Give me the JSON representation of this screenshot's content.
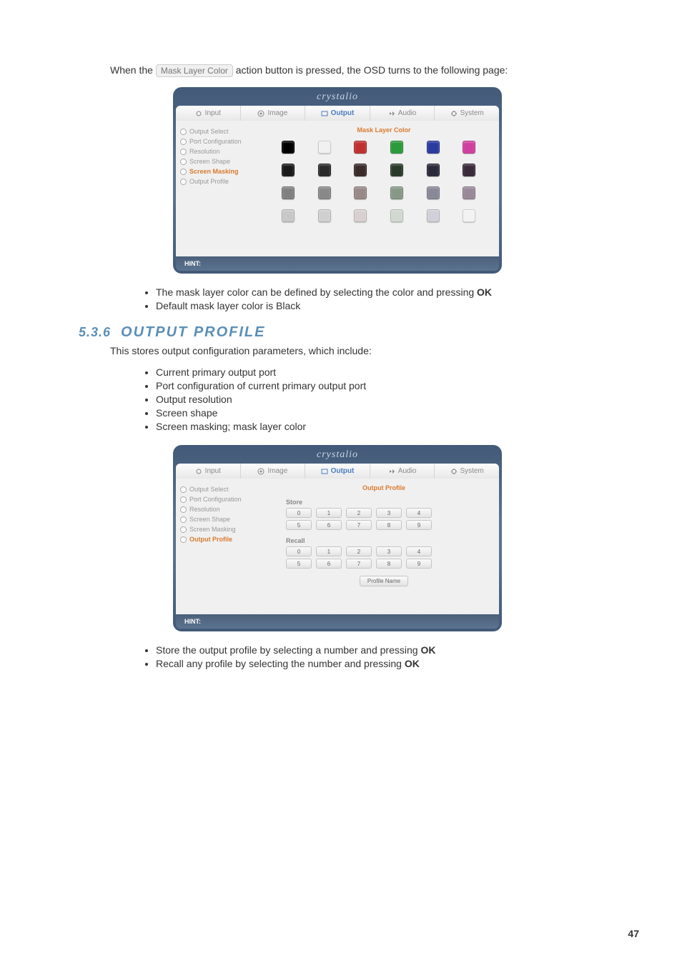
{
  "intro": {
    "prefix": "When the ",
    "pill": "Mask Layer Color",
    "suffix": " action button is pressed, the OSD turns to the following page:"
  },
  "osd1": {
    "logo": "crystalio",
    "tabs": [
      "Input",
      "Image",
      "Output",
      "Audio",
      "System"
    ],
    "active_tab": 2,
    "side": [
      "Output Select",
      "Port Configuration",
      "Resolution",
      "Screen Shape",
      "Screen Masking",
      "Output Profile"
    ],
    "side_active": 4,
    "main_title": "Mask Layer Color",
    "swatches": [
      "#000000",
      "#f0f0f0",
      "#c03030",
      "#2a9a3a",
      "#2a3aa0",
      "#d040a0",
      "#1a1a1a",
      "#2a2a2a",
      "#3a2a2a",
      "#2a3a2a",
      "#2a2a3a",
      "#3a2a3a",
      "#808080",
      "#888888",
      "#988888",
      "#889888",
      "#888898",
      "#988898",
      "#c8c8c8",
      "#d0d0d0",
      "#d8d0d0",
      "#d0d8d0",
      "#d0d0d8",
      "#f2f2f2"
    ],
    "hint": "HINT:"
  },
  "bullets1": [
    {
      "text": "The mask layer color can be defined by selecting the color and pressing ",
      "bold": "OK"
    },
    {
      "text": "Default mask layer color is Black",
      "bold": ""
    }
  ],
  "section": {
    "num": "5.3.6",
    "title": "OUTPUT PROFILE"
  },
  "para2": "This stores output configuration parameters, which include:",
  "bullets2": [
    "Current primary output port",
    "Port configuration of current primary output port",
    "Output resolution",
    "Screen shape",
    "Screen masking; mask layer color"
  ],
  "osd2": {
    "logo": "crystalio",
    "tabs": [
      "Input",
      "Image",
      "Output",
      "Audio",
      "System"
    ],
    "active_tab": 2,
    "side": [
      "Output Select",
      "Port Configuration",
      "Resolution",
      "Screen Shape",
      "Screen Masking",
      "Output Profile"
    ],
    "side_active": 5,
    "main_title": "Output Profile",
    "store_label": "Store",
    "recall_label": "Recall",
    "row1": [
      "0",
      "1",
      "2",
      "3",
      "4"
    ],
    "row2": [
      "5",
      "6",
      "7",
      "8",
      "9"
    ],
    "profile_name": "Profile Name",
    "hint": "HINT:"
  },
  "bullets3": [
    {
      "text": "Store the output profile by selecting a number and pressing ",
      "bold": "OK"
    },
    {
      "text": "Recall any profile by selecting the number and pressing ",
      "bold": "OK"
    }
  ],
  "page_num": "47"
}
